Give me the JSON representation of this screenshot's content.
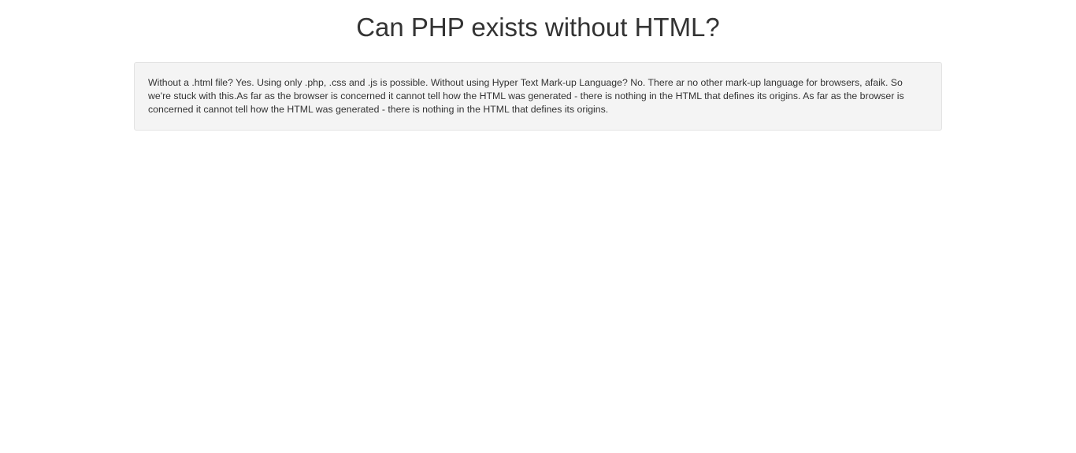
{
  "page": {
    "title": "Can PHP exists without HTML?",
    "answer": "Without a .html file? Yes. Using only .php, .css and .js is possible. Without using Hyper Text Mark-up Language? No. There ar no other mark-up language for browsers, afaik. So we're stuck with this.As far as the browser is concerned it cannot tell how the HTML was generated - there is nothing in the HTML that defines its origins. As far as the browser is concerned it cannot tell how the HTML was generated - there is nothing in the HTML that defines its origins."
  }
}
